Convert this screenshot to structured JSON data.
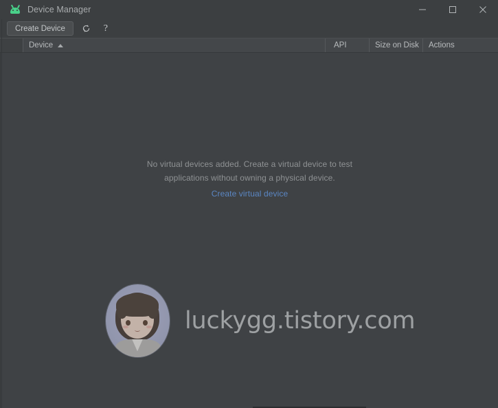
{
  "window": {
    "title": "Device Manager",
    "app_icon": "android-robot-icon",
    "accent_green": "#49d18a",
    "controls": {
      "minimize": "minimize-icon",
      "maximize": "maximize-icon",
      "close": "close-icon"
    }
  },
  "toolbar": {
    "create_device_label": "Create Device",
    "refresh_icon": "refresh-icon",
    "help_label": "?"
  },
  "table": {
    "columns": [
      {
        "key": "gutter",
        "label": ""
      },
      {
        "key": "device",
        "label": "Device",
        "sorted": "ascending",
        "sort_glyph": "▲"
      },
      {
        "key": "api",
        "label": "API"
      },
      {
        "key": "size_on_disk",
        "label": "Size on Disk"
      },
      {
        "key": "actions",
        "label": "Actions"
      }
    ],
    "rows": []
  },
  "empty_state": {
    "line1": "No virtual devices added. Create a virtual device to test",
    "line2": "applications without owning a physical device.",
    "link_label": "Create virtual device",
    "link_color": "#5b87c4"
  },
  "watermark": {
    "text": "luckygg.tistory.com",
    "avatar": "profile-avatar"
  }
}
